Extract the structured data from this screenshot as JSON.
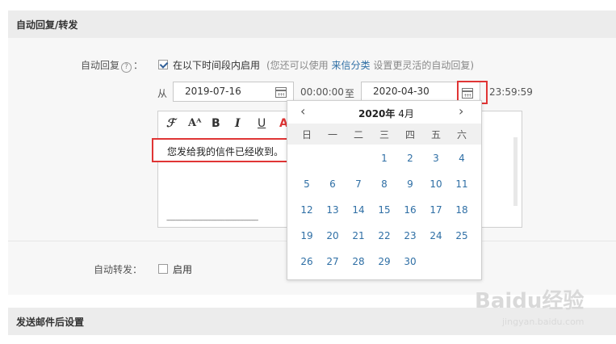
{
  "sections": {
    "auto_reply_title": "自动回复/转发",
    "after_send_title": "发送邮件后设置"
  },
  "auto_reply": {
    "label": "自动回复",
    "label_colon": "：",
    "help_glyph": "?",
    "enable_label": "在以下时间段内启用",
    "hint_prefix": "(您还可以使用",
    "hint_link": "来信分类",
    "hint_suffix": "设置更灵活的自动回复)",
    "enabled": true
  },
  "date_range": {
    "from_label": "从",
    "start_date": "2019-07-16",
    "start_time": "00:00:00",
    "to_label": "至",
    "end_date": "2020-04-30",
    "end_time": "23:59:59"
  },
  "editor": {
    "toolbar": [
      "ℱ",
      "Aᴬ",
      "B",
      "I",
      "U",
      "A"
    ],
    "content": "您发给我的信件已经收到。",
    "signature_line": "------------------------------------------------------------"
  },
  "calendar": {
    "prev": "‹",
    "next": "›",
    "year": "2020年",
    "month": "4月",
    "weekdays": [
      "日",
      "一",
      "二",
      "三",
      "四",
      "五",
      "六"
    ],
    "weeks": [
      [
        "",
        "",
        "",
        "1",
        "2",
        "3",
        "4"
      ],
      [
        "5",
        "6",
        "7",
        "8",
        "9",
        "10",
        "11"
      ],
      [
        "12",
        "13",
        "14",
        "15",
        "16",
        "17",
        "18"
      ],
      [
        "19",
        "20",
        "21",
        "22",
        "23",
        "24",
        "25"
      ],
      [
        "26",
        "27",
        "28",
        "29",
        "30",
        "",
        ""
      ]
    ]
  },
  "auto_forward": {
    "label": "自动转发",
    "label_colon": "：",
    "enable_label": "启用",
    "enabled": false
  },
  "watermark": {
    "brand": "Baidu经验",
    "url": "jingyan.baidu.com"
  },
  "colors": {
    "link": "#2f6fa5",
    "highlight": "#e03535",
    "header_bg": "#ececec",
    "panel_bg": "#f7f7f7"
  }
}
